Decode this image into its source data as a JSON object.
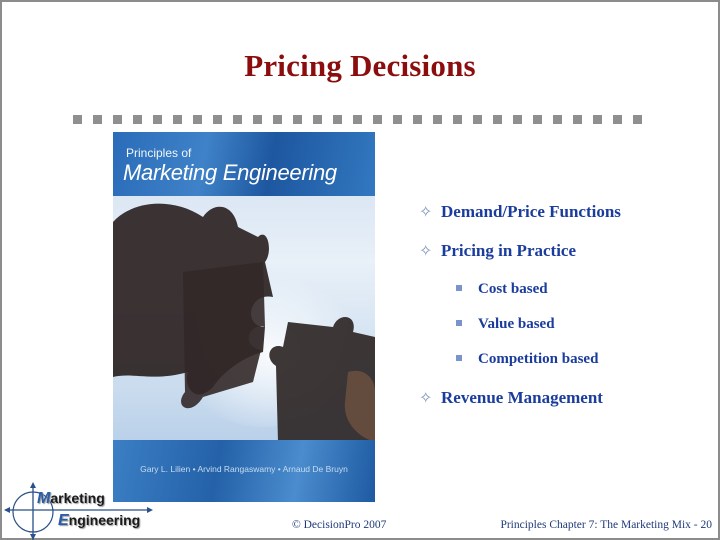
{
  "slide": {
    "title": "Pricing Decisions",
    "divider_squares": 29,
    "book_cover": {
      "subtitle": "Principles of",
      "title": "Marketing Engineering",
      "authors": "Gary L. Lilien • Arvind Rangaswamy • Arnaud De Bruyn"
    },
    "bullets": [
      {
        "marker": "✧",
        "text": "Demand/Price Functions",
        "level": 1
      },
      {
        "marker": "✧",
        "text": "Pricing in Practice",
        "level": 1
      },
      {
        "marker": "▪",
        "text": "Cost based",
        "level": 2
      },
      {
        "marker": "▪",
        "text": "Value based",
        "level": 2
      },
      {
        "marker": "▪",
        "text": "Competition based",
        "level": 2
      },
      {
        "marker": "✧",
        "text": "Revenue Management",
        "level": 1
      }
    ],
    "logo": {
      "line1_cap": "M",
      "line1_rest": "arketing",
      "line2_cap": "E",
      "line2_rest": "ngineering"
    },
    "footer": {
      "copyright": "© DecisionPro 2007",
      "page_info": "Principles Chapter 7: The Marketing Mix - 20"
    }
  },
  "colors": {
    "title": "#8b0d0d",
    "bullet_text": "#1a3c9c",
    "divider": "#8f8f8f",
    "footer_text": "#1f3a7a"
  }
}
